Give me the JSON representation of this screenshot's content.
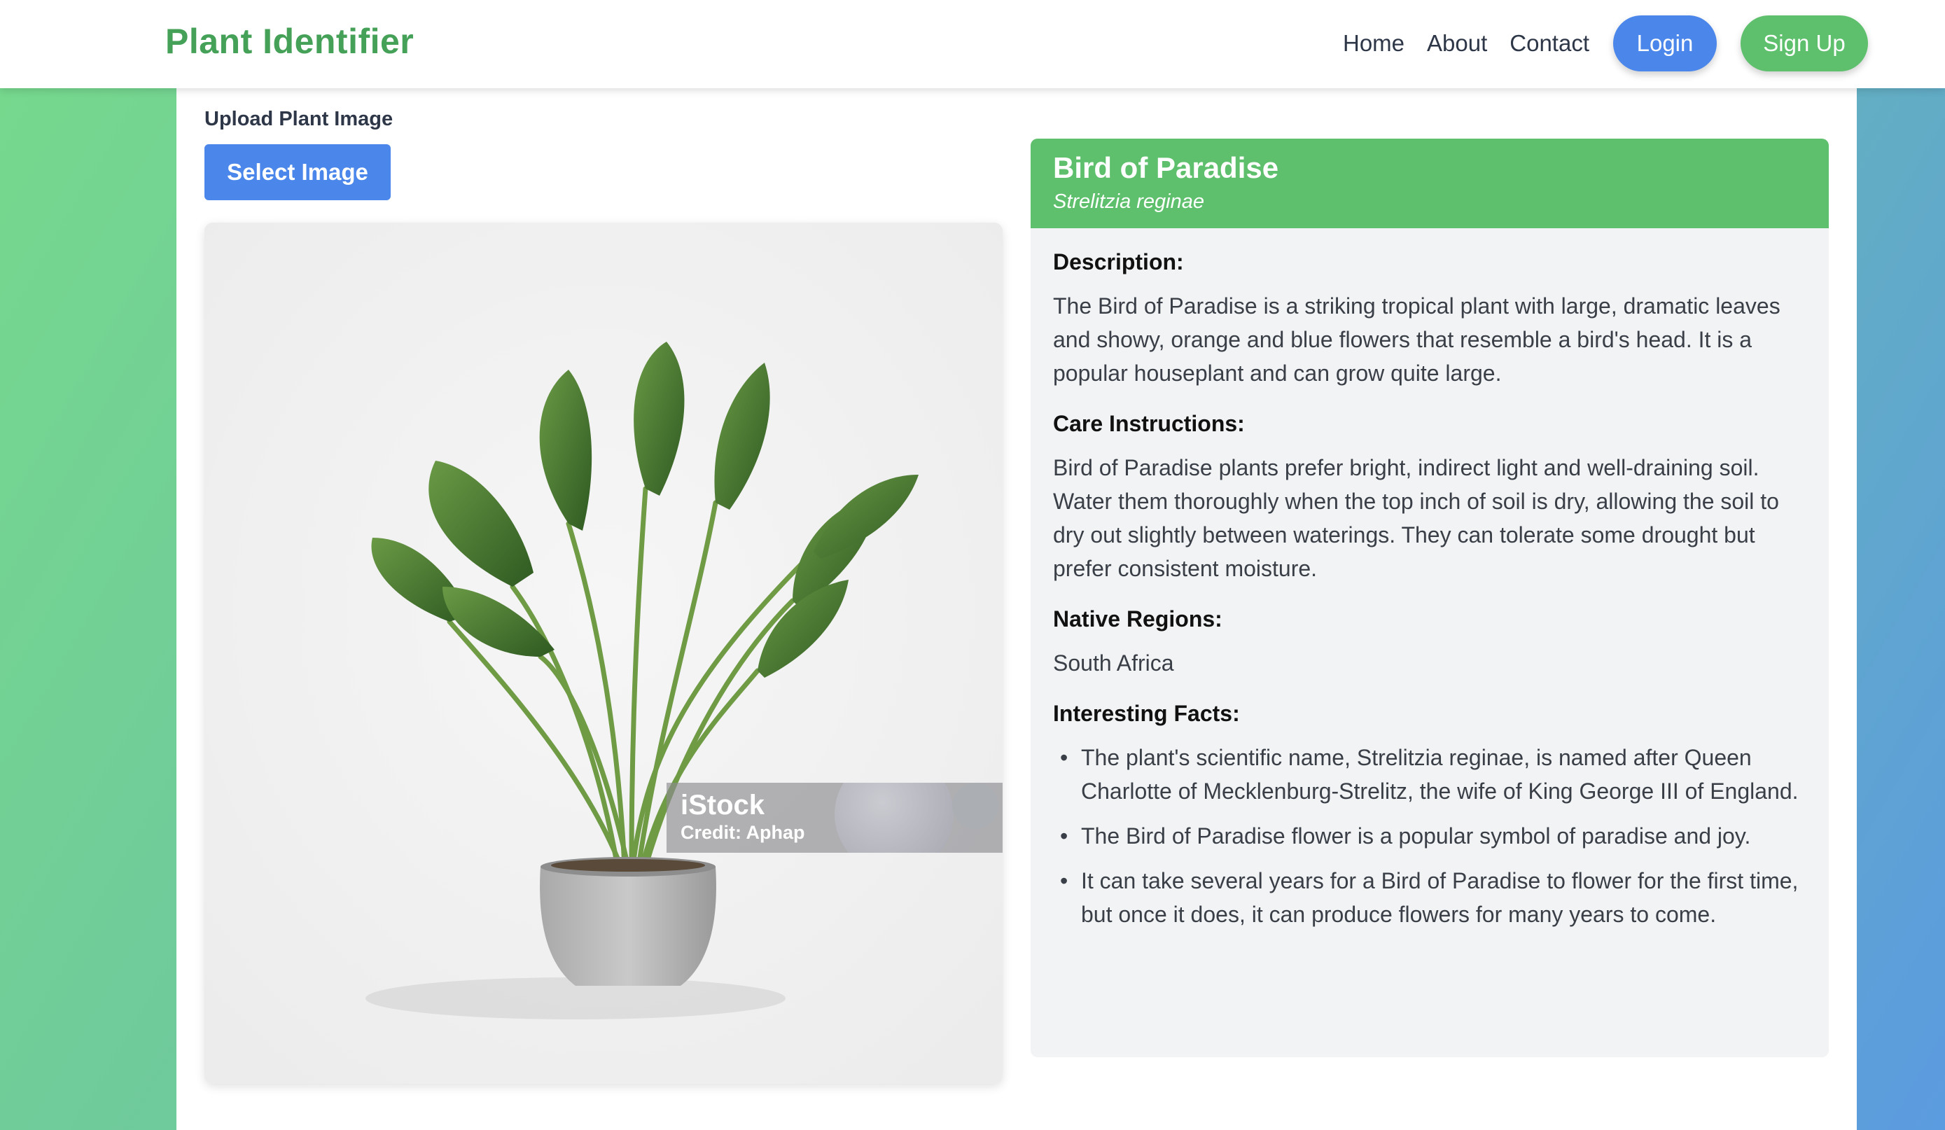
{
  "header": {
    "brand": "Plant Identifier",
    "nav": [
      "Home",
      "About",
      "Contact"
    ],
    "login_label": "Login",
    "signup_label": "Sign Up"
  },
  "upload": {
    "label": "Upload Plant Image",
    "button_label": "Select Image"
  },
  "image": {
    "watermark_logo": "iStock",
    "watermark_credit": "Credit: Aphap"
  },
  "plant": {
    "name": "Bird of Paradise",
    "scientific_name": "Strelitzia reginae",
    "description_title": "Description:",
    "description": "The Bird of Paradise is a striking tropical plant with large, dramatic leaves and showy, orange and blue flowers that resemble a bird's head. It is a popular houseplant and can grow quite large.",
    "care_title": "Care Instructions:",
    "care": "Bird of Paradise plants prefer bright, indirect light and well-draining soil. Water them thoroughly when the top inch of soil is dry, allowing the soil to dry out slightly between waterings. They can tolerate some drought but prefer consistent moisture.",
    "regions_title": "Native Regions:",
    "regions": "South Africa",
    "facts_title": "Interesting Facts:",
    "facts": [
      "The plant's scientific name, Strelitzia reginae, is named after Queen Charlotte of Mecklenburg-Strelitz, the wife of King George III of England.",
      "The Bird of Paradise flower is a popular symbol of paradise and joy.",
      "It can take several years for a Bird of Paradise to flower for the first time, but once it does, it can produce flowers for many years to come."
    ]
  },
  "colors": {
    "brand_green": "#44a157",
    "accent_green": "#5ec06c",
    "accent_blue": "#4b86ea"
  }
}
